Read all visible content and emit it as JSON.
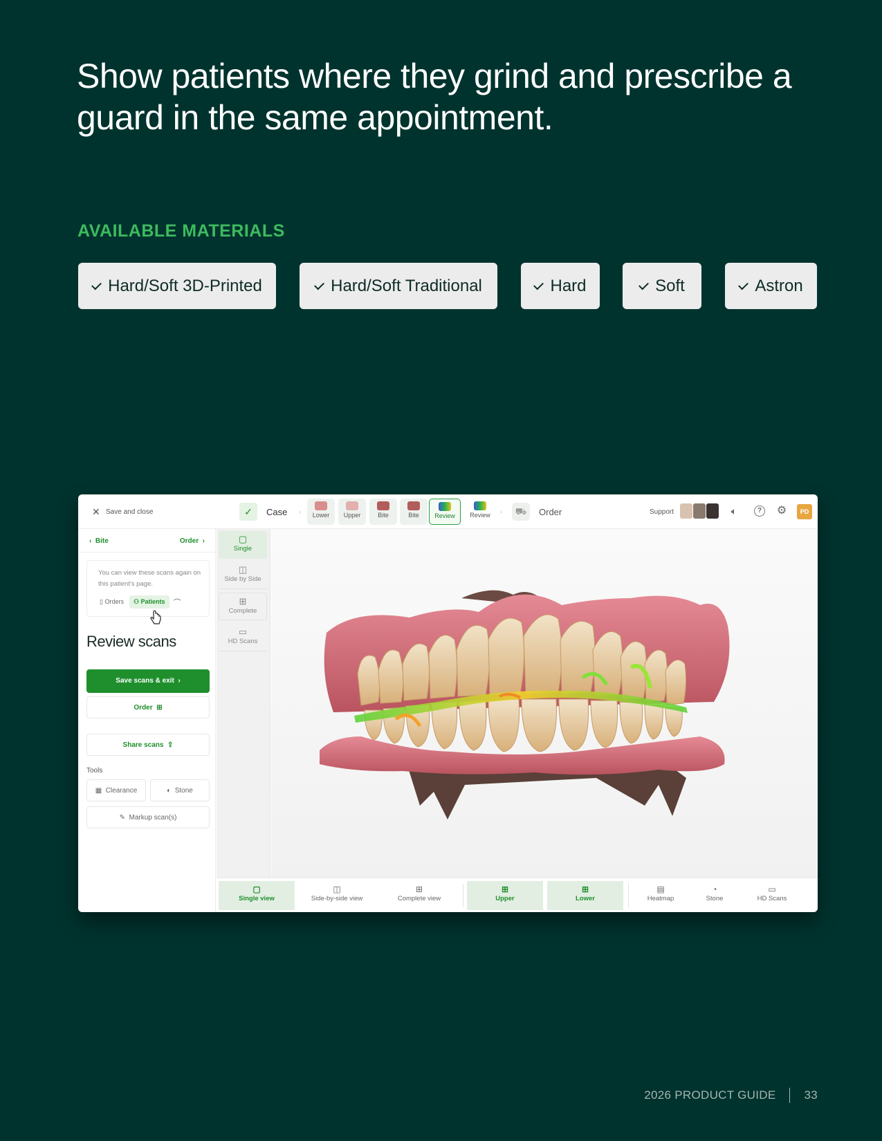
{
  "headline": "Show patients where they grind and prescribe a guard in the same appointment.",
  "materials": {
    "heading": "AVAILABLE MATERIALS",
    "items": [
      "Hard/Soft 3D-Printed",
      "Hard/Soft Traditional",
      "Hard",
      "Soft",
      "Astron"
    ]
  },
  "app": {
    "topbar": {
      "save_close": "Save and close",
      "case_label": "Case",
      "steps": [
        "Lower",
        "Upper",
        "Bite",
        "Bite",
        "Review",
        "Review"
      ],
      "order_label": "Order",
      "support_label": "Support",
      "user_initials": "PD"
    },
    "left_panel": {
      "back_label": "Bite",
      "forward_label": "Order",
      "info_text": "You can view these scans again on this patient's page.",
      "orders_link": "Orders",
      "patients_link": "Patients",
      "title": "Review scans",
      "save_exit_button": "Save scans & exit",
      "order_button": "Order",
      "share_button": "Share scans",
      "tools_label": "Tools",
      "clearance_button": "Clearance",
      "stone_button": "Stone",
      "markup_button": "Markup scan(s)"
    },
    "view_column": [
      "Single",
      "Side by Side",
      "Complete",
      "HD Scans"
    ],
    "bottom_bar": [
      "Single view",
      "Side-by-side view",
      "Complete view",
      "Upper",
      "Lower",
      "Heatmap",
      "Stone",
      "HD Scans"
    ]
  },
  "footer": {
    "guide": "2026 PRODUCT GUIDE",
    "page_number": "33"
  },
  "colors": {
    "background": "#00332e",
    "accent_green": "#3dbb5e",
    "app_green": "#1e8f2c",
    "user_badge": "#e8a640"
  }
}
